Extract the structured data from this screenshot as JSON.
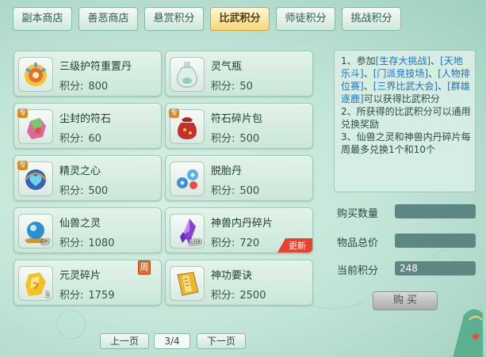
{
  "tabs": [
    {
      "label": "副本商店",
      "active": false
    },
    {
      "label": "善恶商店",
      "active": false
    },
    {
      "label": "悬赏积分",
      "active": false
    },
    {
      "label": "比武积分",
      "active": true
    },
    {
      "label": "师徒积分",
      "active": false
    },
    {
      "label": "挑战积分",
      "active": false
    }
  ],
  "points_label": "积分:",
  "items": [
    {
      "name": "三级护符重置丹",
      "points": "800",
      "icon": "golden-pill-icon"
    },
    {
      "name": "灵气瓶",
      "points": "50",
      "icon": "spirit-bottle-icon"
    },
    {
      "name": "尘封的符石",
      "points": "60",
      "icon": "rune-stone-icon",
      "badge": "专"
    },
    {
      "name": "符石碎片包",
      "points": "500",
      "icon": "rune-bag-icon",
      "badge": "专"
    },
    {
      "name": "精灵之心",
      "points": "500",
      "icon": "spirit-heart-icon",
      "badge": "专"
    },
    {
      "name": "脱胎丹",
      "points": "500",
      "icon": "rebirth-pill-icon"
    },
    {
      "name": "仙兽之灵",
      "points": "1080",
      "icon": "beast-soul-orb-icon",
      "count": "47"
    },
    {
      "name": "神兽内丹碎片",
      "points": "720",
      "icon": "beast-core-shard-icon",
      "count": "129",
      "tag": "更新"
    },
    {
      "name": "元灵碎片",
      "points": "1759",
      "icon": "yuanling-shard-icon",
      "count": "1",
      "week": "周"
    },
    {
      "name": "神功要诀",
      "points": "2500",
      "icon": "secret-manual-icon"
    }
  ],
  "rules": {
    "p1a": "1、参加",
    "e1": "[生存大挑战]",
    "p1b": "、",
    "e2": "[天地乐斗]",
    "p1c": "、",
    "e3": "[门派竞技场]",
    "p1d": "、",
    "e4": "[人物排位赛]",
    "p1e": "、",
    "e5": "[三界比武大会]",
    "p1f": "、",
    "e6": "[群雄逐鹿]",
    "p1g": "可以获得比武积分",
    "p2": "2、所获得的比武积分可以通用兑换奖励",
    "p3": "3、仙兽之灵和神兽内丹碎片每周最多兑换1个和10个"
  },
  "form": {
    "quantity_label": "购买数量",
    "quantity_value": "",
    "total_label": "物品总价",
    "total_value": "",
    "current_label": "当前积分",
    "current_value": "248"
  },
  "buy_label": "购 买",
  "pagination": {
    "prev": "上一页",
    "page": "3/4",
    "next": "下一页"
  }
}
